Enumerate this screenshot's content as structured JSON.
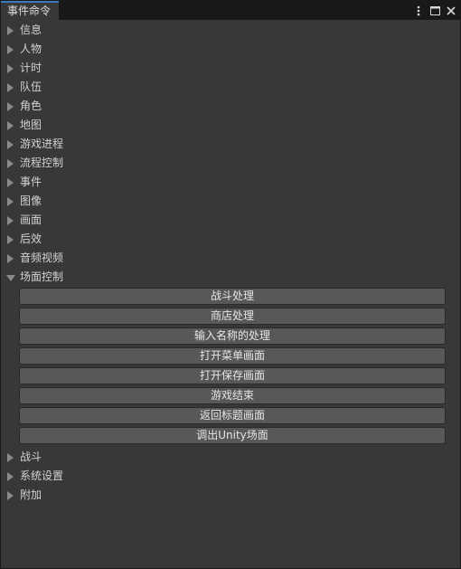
{
  "window": {
    "tab_title": "事件命令",
    "icons": [
      "more-vert-icon",
      "maximize-icon",
      "close-icon"
    ]
  },
  "tree": {
    "nodes_before": [
      {
        "label": "信息"
      },
      {
        "label": "人物"
      },
      {
        "label": "计时"
      },
      {
        "label": "队伍"
      },
      {
        "label": "角色"
      },
      {
        "label": "地图"
      },
      {
        "label": "游戏进程"
      },
      {
        "label": "流程控制"
      },
      {
        "label": "事件"
      },
      {
        "label": "图像"
      },
      {
        "label": "画面"
      },
      {
        "label": "后效"
      },
      {
        "label": "音频视频"
      }
    ],
    "expanded": {
      "label": "场面控制",
      "actions": [
        "战斗处理",
        "商店处理",
        "输入名称的处理",
        "打开菜单画面",
        "打开保存画面",
        "游戏结束",
        "返回标题画面",
        "调出Unity场面"
      ]
    },
    "nodes_after": [
      {
        "label": "战斗"
      },
      {
        "label": "系统设置"
      },
      {
        "label": "附加"
      }
    ]
  }
}
